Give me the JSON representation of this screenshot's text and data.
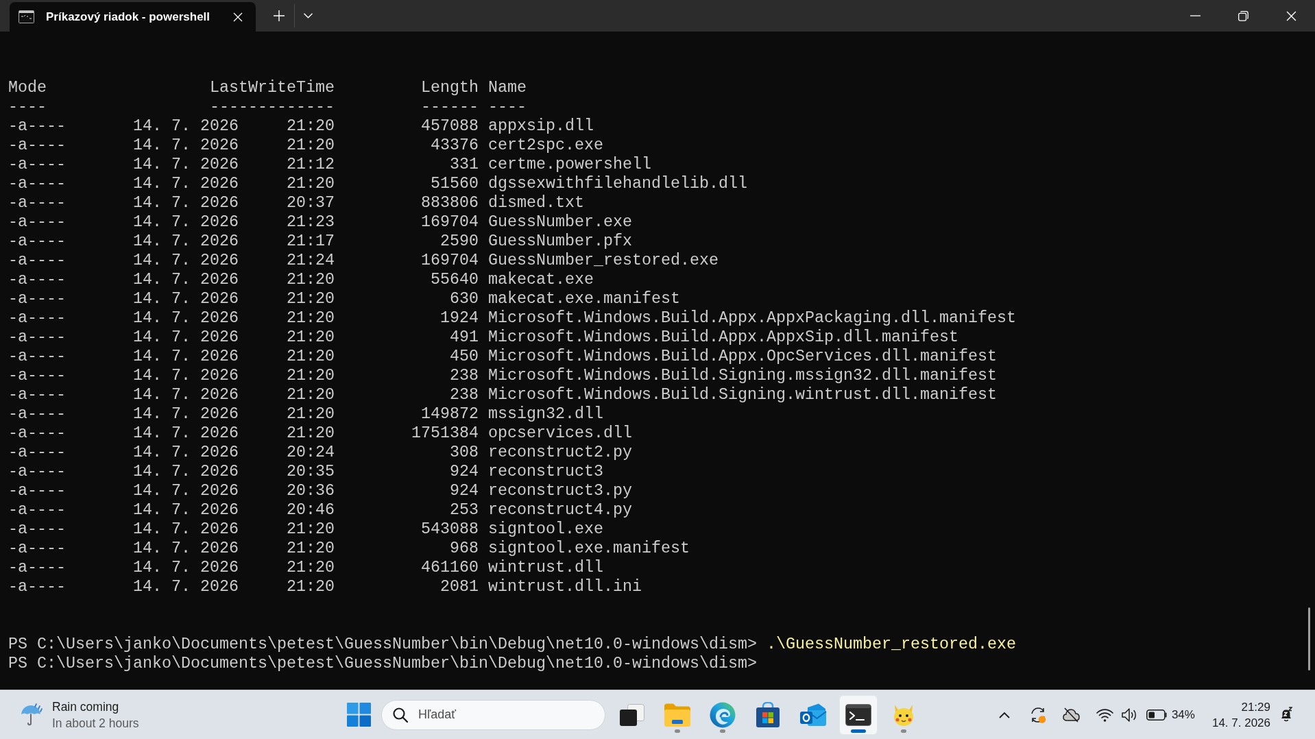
{
  "tabs": [
    {
      "title": "Príkazový riadok - powershell",
      "selected": true
    }
  ],
  "listing": {
    "columns": [
      {
        "label": "Mode",
        "rule": "----"
      },
      {
        "label": "LastWriteTime",
        "rule": "-------------"
      },
      {
        "label": "Length",
        "rule": "------"
      },
      {
        "label": "Name",
        "rule": "----"
      }
    ],
    "rows": [
      {
        "mode": "-a----",
        "date": "14. 7. 2026",
        "time": "21:20",
        "length": "457088",
        "name": "appxsip.dll"
      },
      {
        "mode": "-a----",
        "date": "14. 7. 2026",
        "time": "21:20",
        "length": "43376",
        "name": "cert2spc.exe"
      },
      {
        "mode": "-a----",
        "date": "14. 7. 2026",
        "time": "21:12",
        "length": "331",
        "name": "certme.powershell"
      },
      {
        "mode": "-a----",
        "date": "14. 7. 2026",
        "time": "21:20",
        "length": "51560",
        "name": "dgssexwithfilehandlelib.dll"
      },
      {
        "mode": "-a----",
        "date": "14. 7. 2026",
        "time": "20:37",
        "length": "883806",
        "name": "dismed.txt"
      },
      {
        "mode": "-a----",
        "date": "14. 7. 2026",
        "time": "21:23",
        "length": "169704",
        "name": "GuessNumber.exe"
      },
      {
        "mode": "-a----",
        "date": "14. 7. 2026",
        "time": "21:17",
        "length": "2590",
        "name": "GuessNumber.pfx"
      },
      {
        "mode": "-a----",
        "date": "14. 7. 2026",
        "time": "21:24",
        "length": "169704",
        "name": "GuessNumber_restored.exe"
      },
      {
        "mode": "-a----",
        "date": "14. 7. 2026",
        "time": "21:20",
        "length": "55640",
        "name": "makecat.exe"
      },
      {
        "mode": "-a----",
        "date": "14. 7. 2026",
        "time": "21:20",
        "length": "630",
        "name": "makecat.exe.manifest"
      },
      {
        "mode": "-a----",
        "date": "14. 7. 2026",
        "time": "21:20",
        "length": "1924",
        "name": "Microsoft.Windows.Build.Appx.AppxPackaging.dll.manifest"
      },
      {
        "mode": "-a----",
        "date": "14. 7. 2026",
        "time": "21:20",
        "length": "491",
        "name": "Microsoft.Windows.Build.Appx.AppxSip.dll.manifest"
      },
      {
        "mode": "-a----",
        "date": "14. 7. 2026",
        "time": "21:20",
        "length": "450",
        "name": "Microsoft.Windows.Build.Appx.OpcServices.dll.manifest"
      },
      {
        "mode": "-a----",
        "date": "14. 7. 2026",
        "time": "21:20",
        "length": "238",
        "name": "Microsoft.Windows.Build.Signing.mssign32.dll.manifest"
      },
      {
        "mode": "-a----",
        "date": "14. 7. 2026",
        "time": "21:20",
        "length": "238",
        "name": "Microsoft.Windows.Build.Signing.wintrust.dll.manifest"
      },
      {
        "mode": "-a----",
        "date": "14. 7. 2026",
        "time": "21:20",
        "length": "149872",
        "name": "mssign32.dll"
      },
      {
        "mode": "-a----",
        "date": "14. 7. 2026",
        "time": "21:20",
        "length": "1751384",
        "name": "opcservices.dll"
      },
      {
        "mode": "-a----",
        "date": "14. 7. 2026",
        "time": "20:24",
        "length": "308",
        "name": "reconstruct2.py"
      },
      {
        "mode": "-a----",
        "date": "14. 7. 2026",
        "time": "20:35",
        "length": "924",
        "name": "reconstruct3"
      },
      {
        "mode": "-a----",
        "date": "14. 7. 2026",
        "time": "20:36",
        "length": "924",
        "name": "reconstruct3.py"
      },
      {
        "mode": "-a----",
        "date": "14. 7. 2026",
        "time": "20:46",
        "length": "253",
        "name": "reconstruct4.py"
      },
      {
        "mode": "-a----",
        "date": "14. 7. 2026",
        "time": "21:20",
        "length": "543088",
        "name": "signtool.exe"
      },
      {
        "mode": "-a----",
        "date": "14. 7. 2026",
        "time": "21:20",
        "length": "968",
        "name": "signtool.exe.manifest"
      },
      {
        "mode": "-a----",
        "date": "14. 7. 2026",
        "time": "21:20",
        "length": "461160",
        "name": "wintrust.dll"
      },
      {
        "mode": "-a----",
        "date": "14. 7. 2026",
        "time": "21:20",
        "length": "2081",
        "name": "wintrust.dll.ini"
      }
    ]
  },
  "prompt_lines": [
    {
      "prompt": "PS C:\\Users\\janko\\Documents\\petest\\GuessNumber\\bin\\Debug\\net10.0-windows\\dism>",
      "command": ".\\GuessNumber_restored.exe"
    },
    {
      "prompt": "PS C:\\Users\\janko\\Documents\\petest\\GuessNumber\\bin\\Debug\\net10.0-windows\\dism>"
    }
  ],
  "taskbar": {
    "weather": {
      "title": "Rain coming",
      "subtitle": "In about 2 hours"
    },
    "search": {
      "placeholder": "Hľadať"
    },
    "apps": [
      {
        "kind": "task-view",
        "running": false,
        "selected": false
      },
      {
        "kind": "files",
        "running": true,
        "selected": false
      },
      {
        "kind": "browser",
        "running": true,
        "selected": false
      },
      {
        "kind": "store",
        "running": false,
        "selected": false
      },
      {
        "kind": "mail",
        "running": false,
        "selected": false
      },
      {
        "kind": "terminal",
        "running": true,
        "selected": true
      },
      {
        "kind": "mascot",
        "running": true,
        "selected": false
      }
    ],
    "tray": {
      "battery_percent": "34%",
      "time": "21:29",
      "date": "14. 7. 2026"
    }
  }
}
